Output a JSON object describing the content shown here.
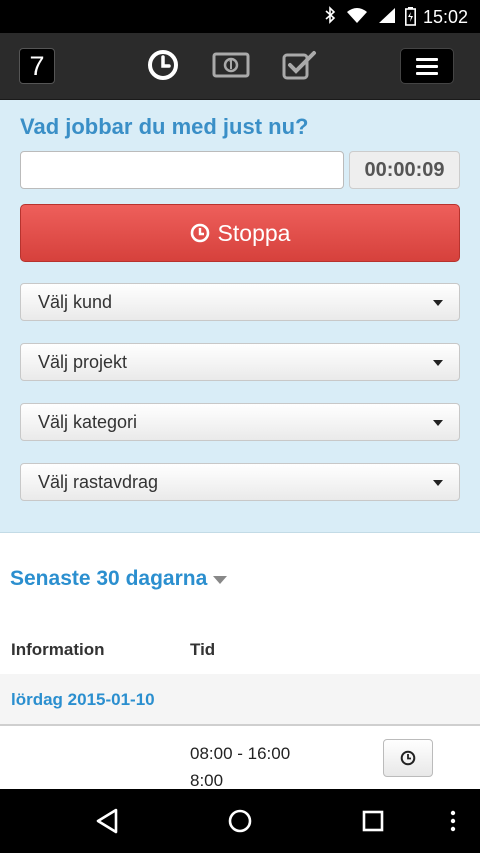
{
  "status_bar": {
    "time": "15:02",
    "icons": [
      "bluetooth-icon",
      "wifi-icon",
      "signal-icon",
      "battery-icon"
    ]
  },
  "app_header": {
    "logo_text": "7",
    "nav_icons": [
      "clock-icon",
      "money-icon",
      "checkbox-icon",
      "menu-icon"
    ],
    "active_icon": "clock-icon"
  },
  "tracker": {
    "question": "Vad jobbar du med just nu?",
    "task_value": "",
    "task_placeholder": "",
    "timer": "00:00:09",
    "stop_label": "Stoppa",
    "selects": [
      {
        "label": "Välj kund"
      },
      {
        "label": "Välj projekt"
      },
      {
        "label": "Välj kategori"
      },
      {
        "label": "Välj rastavdrag"
      }
    ]
  },
  "recent": {
    "title": "Senaste 30 dagarna",
    "columns": [
      "Information",
      "Tid"
    ],
    "days": [
      {
        "date": "lördag 2015-01-10",
        "entries": [
          {
            "range": "08:00 - 16:00",
            "duration": "8:00"
          }
        ]
      }
    ]
  },
  "colors": {
    "panel_bg": "#d9edf7",
    "accent_blue": "#2b8fcf",
    "stop_red": "#e04e4a",
    "header_bg": "#2b2b2b"
  },
  "nav_bar": {
    "buttons": [
      "back-icon",
      "home-icon",
      "recents-icon",
      "overflow-icon"
    ]
  }
}
